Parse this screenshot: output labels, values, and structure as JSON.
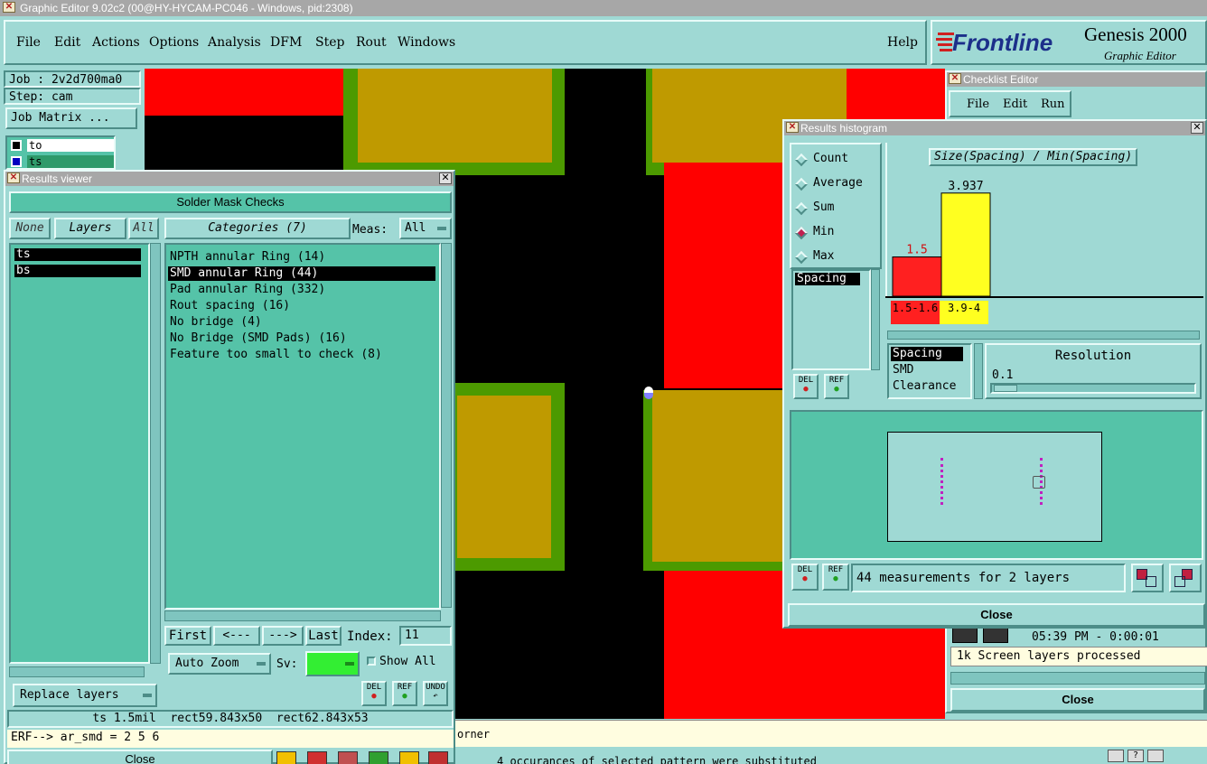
{
  "window": {
    "title": "Graphic Editor 9.02c2 (00@HY-HYCAM-PC046 - Windows, pid:2308)"
  },
  "menu": {
    "items": [
      "File",
      "Edit",
      "Actions",
      "Options",
      "Analysis",
      "DFM",
      "Step",
      "Rout",
      "Windows"
    ],
    "help": "Help"
  },
  "brand": {
    "name": "Frontline",
    "product": "Genesis 2000",
    "subtitle": "Graphic Editor"
  },
  "job": {
    "job_label": "Job : 2v2d700ma0",
    "step_label": "Step: cam",
    "matrix_button": "Job Matrix ..."
  },
  "layer_list": {
    "items": [
      "to",
      "ts"
    ]
  },
  "results_viewer": {
    "title": "Results viewer",
    "header": "Solder Mask Checks",
    "none_btn": "None",
    "layers_btn": "Layers",
    "all_btn": "All",
    "categories_btn": "Categories (7)",
    "meas_label": "Meas:",
    "meas_value": "All",
    "layers": [
      "ts",
      "bs"
    ],
    "categories": [
      "NPTH annular Ring (14)",
      "SMD annular Ring (44)",
      "Pad annular Ring (332)",
      "Rout spacing (16)",
      "No bridge (4)",
      "No Bridge (SMD Pads) (16)",
      "Feature too small to check (8)"
    ],
    "selected_category_index": 1,
    "nav": {
      "first": "First",
      "prev": "<---",
      "next": "--->",
      "last": "Last",
      "index_label": "Index:",
      "index_value": "11"
    },
    "auto_zoom": "Auto Zoom",
    "sv_label": "Sv:",
    "show_all": "Show All",
    "replace_layers": "Replace layers",
    "small_buttons": [
      "DEL",
      "REF",
      "UNDO"
    ],
    "status_line": "ts 1.5mil  rect59.843x50  rect62.843x53",
    "erf_line": "ERF--> ar_smd = 2 5 6",
    "close": "Close"
  },
  "histogram": {
    "title": "Results histogram",
    "modes": [
      "Count",
      "Average",
      "Sum",
      "Min",
      "Max"
    ],
    "selected_mode": "Min",
    "measure_list": [
      "Spacing"
    ],
    "chart_title": "Size(Spacing) / Min(Spacing)",
    "resolution_label": "Resolution",
    "resolution_value": "0.1",
    "type_list": [
      "Spacing",
      "SMD",
      "Clearance"
    ],
    "bins": [
      "1.5-1.6",
      "3.9-4"
    ],
    "summary": "44 measurements for 2 layers",
    "close": "Close",
    "small_buttons": [
      "DEL",
      "REF"
    ]
  },
  "chart_data": {
    "type": "bar",
    "title": "Size(Spacing) / Min(Spacing)",
    "categories": [
      "1.5-1.6",
      "3.9-4"
    ],
    "values": [
      1.5,
      3.937
    ],
    "value_labels": [
      "1.5",
      "3.937"
    ],
    "colors": [
      "#ff2020",
      "#ffff20"
    ],
    "ylim": [
      0,
      4.5
    ]
  },
  "checklist": {
    "title": "Checklist Editor",
    "menu": [
      "File",
      "Edit",
      "Run"
    ],
    "time": "05:39 PM - 0:00:01",
    "status": "1k Screen layers processed",
    "close": "Close"
  },
  "bottom": {
    "orner": "orner",
    "message": "4 occurances of selected pattern were substituted"
  },
  "colors": {
    "ui": "#9fd9d4",
    "copper": "#bf9a00",
    "mask": "#ff0000",
    "trace_green": "#4c9a00"
  }
}
